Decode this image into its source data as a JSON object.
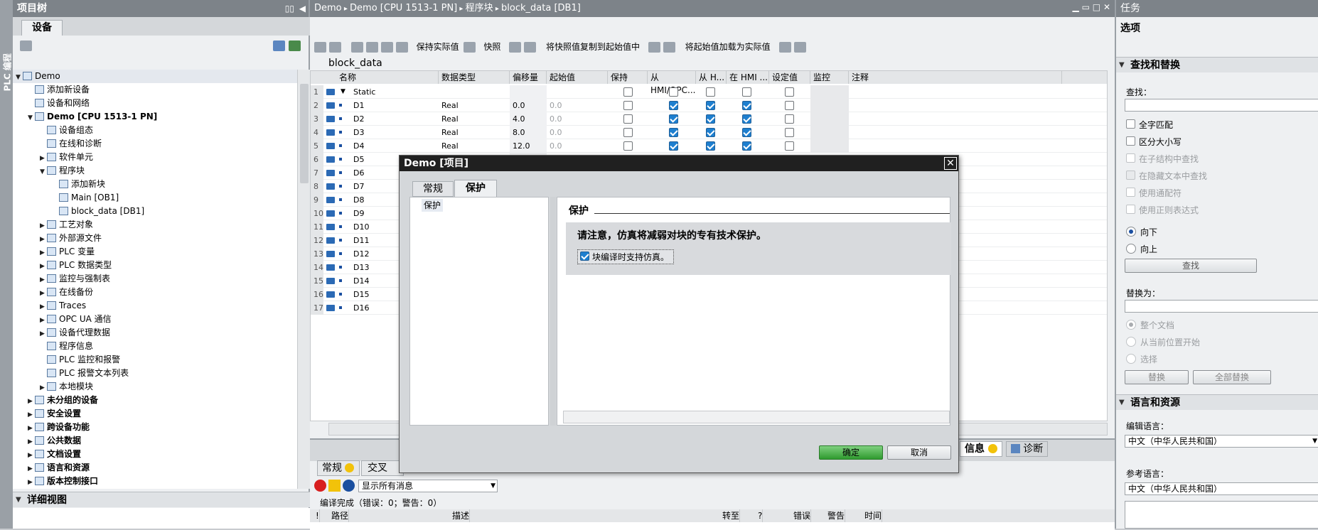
{
  "project_tree": {
    "title": "项目树",
    "tab": "设备",
    "side_label": "PLC 编程",
    "items": [
      {
        "label": "Demo",
        "level": 0,
        "arrow": "▼"
      },
      {
        "label": "添加新设备",
        "level": 1,
        "arrow": ""
      },
      {
        "label": "设备和网络",
        "level": 1,
        "arrow": ""
      },
      {
        "label": "Demo [CPU 1513-1 PN]",
        "level": 1,
        "arrow": "▼"
      },
      {
        "label": "设备组态",
        "level": 2,
        "arrow": ""
      },
      {
        "label": "在线和诊断",
        "level": 2,
        "arrow": ""
      },
      {
        "label": "软件单元",
        "level": 2,
        "arrow": "▶"
      },
      {
        "label": "程序块",
        "level": 2,
        "arrow": "▼"
      },
      {
        "label": "添加新块",
        "level": 3,
        "arrow": ""
      },
      {
        "label": "Main [OB1]",
        "level": 3,
        "arrow": ""
      },
      {
        "label": "block_data [DB1]",
        "level": 3,
        "arrow": ""
      },
      {
        "label": "工艺对象",
        "level": 2,
        "arrow": "▶"
      },
      {
        "label": "外部源文件",
        "level": 2,
        "arrow": "▶"
      },
      {
        "label": "PLC 变量",
        "level": 2,
        "arrow": "▶"
      },
      {
        "label": "PLC 数据类型",
        "level": 2,
        "arrow": "▶"
      },
      {
        "label": "监控与强制表",
        "level": 2,
        "arrow": "▶"
      },
      {
        "label": "在线备份",
        "level": 2,
        "arrow": "▶"
      },
      {
        "label": "Traces",
        "level": 2,
        "arrow": "▶"
      },
      {
        "label": "OPC UA 通信",
        "level": 2,
        "arrow": "▶"
      },
      {
        "label": "设备代理数据",
        "level": 2,
        "arrow": "▶"
      },
      {
        "label": "程序信息",
        "level": 2,
        "arrow": ""
      },
      {
        "label": "PLC 监控和报警",
        "level": 2,
        "arrow": ""
      },
      {
        "label": "PLC 报警文本列表",
        "level": 2,
        "arrow": ""
      },
      {
        "label": "本地模块",
        "level": 2,
        "arrow": "▶"
      },
      {
        "label": "未分组的设备",
        "level": 1,
        "arrow": "▶"
      },
      {
        "label": "安全设置",
        "level": 1,
        "arrow": "▶"
      },
      {
        "label": "跨设备功能",
        "level": 1,
        "arrow": "▶"
      },
      {
        "label": "公共数据",
        "level": 1,
        "arrow": "▶"
      },
      {
        "label": "文档设置",
        "level": 1,
        "arrow": "▶"
      },
      {
        "label": "语言和资源",
        "level": 1,
        "arrow": "▶"
      },
      {
        "label": "版本控制接口",
        "level": 1,
        "arrow": "▶"
      }
    ],
    "detail_view": "详细视图"
  },
  "editor": {
    "breadcrumb": [
      "Demo",
      "Demo [CPU 1513-1 PN]",
      "程序块",
      "block_data [DB1]"
    ],
    "toolbar": {
      "keep_actual": "保持实际值",
      "snapshot": "快照",
      "copy_snapshot": "将快照值复制到起始值中",
      "load_start": "将起始值加载为实际值"
    },
    "block_name": "block_data",
    "columns": [
      "名称",
      "数据类型",
      "偏移量",
      "起始值",
      "保持",
      "从 HMI/OPC...",
      "从 H...",
      "在 HMI ...",
      "设定值",
      "监控",
      "注释"
    ],
    "rows": [
      {
        "n": "1",
        "name": "Static",
        "type": "",
        "offset": "",
        "start": ""
      },
      {
        "n": "2",
        "name": "D1",
        "type": "Real",
        "offset": "0.0",
        "start": "0.0"
      },
      {
        "n": "3",
        "name": "D2",
        "type": "Real",
        "offset": "4.0",
        "start": "0.0"
      },
      {
        "n": "4",
        "name": "D3",
        "type": "Real",
        "offset": "8.0",
        "start": "0.0"
      },
      {
        "n": "5",
        "name": "D4",
        "type": "Real",
        "offset": "12.0",
        "start": "0.0"
      },
      {
        "n": "6",
        "name": "D5"
      },
      {
        "n": "7",
        "name": "D6"
      },
      {
        "n": "8",
        "name": "D7"
      },
      {
        "n": "9",
        "name": "D8"
      },
      {
        "n": "10",
        "name": "D9"
      },
      {
        "n": "11",
        "name": "D10"
      },
      {
        "n": "12",
        "name": "D11"
      },
      {
        "n": "13",
        "name": "D12"
      },
      {
        "n": "14",
        "name": "D13"
      },
      {
        "n": "15",
        "name": "D14"
      },
      {
        "n": "16",
        "name": "D15"
      },
      {
        "n": "17",
        "name": "D16"
      }
    ]
  },
  "inspector": {
    "tabs": [
      "常规",
      "交叉"
    ],
    "filter": "显示所有消息",
    "status": "编译完成（错误：0；警告：0）",
    "cols": [
      "!",
      "路径",
      "描述",
      "转至",
      "?",
      "错误",
      "警告",
      "时间"
    ],
    "right_tabs": [
      "信息",
      "诊断"
    ]
  },
  "dialog": {
    "title": "Demo [项目]",
    "tabs": [
      "常规",
      "保护"
    ],
    "nav_item": "保护",
    "section": "保护",
    "notice": "请注意，仿真将减弱对块的专有技术保护。",
    "checkbox": "块编译时支持仿真。",
    "ok": "确定",
    "cancel": "取消"
  },
  "tasks": {
    "title": "任务",
    "options": "选项",
    "find_replace": {
      "header": "查找和替换",
      "find_label": "查找：",
      "whole_word": "全字匹配",
      "match_case": "区分大小写",
      "in_sub": "在子结构中查找",
      "in_hidden": "在隐藏文本中查找",
      "wildcards": "使用通配符",
      "regex": "使用正则表达式",
      "down": "向下",
      "up": "向上",
      "find_btn": "查找",
      "replace_label": "替换为：",
      "whole_doc": "整个文档",
      "from_pos": "从当前位置开始",
      "selection": "选择",
      "replace_btn": "替换",
      "replace_all": "全部替换"
    },
    "lang": {
      "header": "语言和资源",
      "edit_lang_label": "编辑语言：",
      "edit_lang": "中文（中华人民共和国）",
      "ref_lang_label": "参考语言：",
      "ref_lang": "中文（中华人民共和国）"
    }
  }
}
